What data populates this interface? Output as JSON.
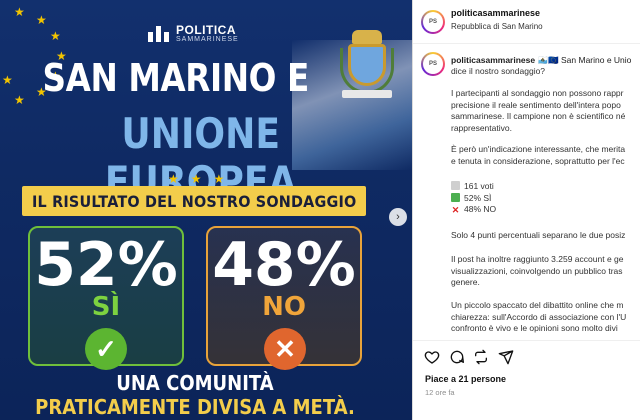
{
  "post_image": {
    "brand_line1": "POLITICA",
    "brand_line2": "SAMMARINESE",
    "title_line1": "SAN MARINO E",
    "title_line2": "UNIONE EUROPEA",
    "banner": "IL RISULTATO DEL NOSTRO SONDAGGIO",
    "yes": {
      "percent": "52%",
      "label": "SÌ",
      "icon": "check-icon",
      "color": "#7dd240"
    },
    "no": {
      "percent": "48%",
      "label": "NO",
      "icon": "x-icon",
      "color": "#f0a53a"
    },
    "footer_line1": "UNA COMUNITÀ",
    "footer_line2": "PRATICAMENTE DIVISA A METÀ."
  },
  "header": {
    "username": "politicasammarinese",
    "location": "Repubblica di San Marino"
  },
  "caption": {
    "username": "politicasammarinese",
    "first_line_rest": " 🇸🇲🇪🇺 San Marino e Unio",
    "first_line_2": "dice il nostro sondaggio?",
    "para1": [
      "I partecipanti al sondaggio non possono rappr",
      "precisione il reale sentimento dell'intera popo",
      "sammarinese. Il campione non è scientifico né",
      "rappresentativo."
    ],
    "para2": [
      "È però un'indicazione interessante, che merita",
      "e tenuta in considerazione, soprattutto per l'ec"
    ],
    "stats": [
      {
        "icon": "chart-icon",
        "text": "161 voti"
      },
      {
        "icon": "check-icon",
        "text": "52% SÌ"
      },
      {
        "icon": "x-icon",
        "text": "48% NO"
      }
    ],
    "para3": [
      "Solo 4 punti percentuali separano le due posiz"
    ],
    "para4": [
      "Il post ha inoltre raggiunto 3.259 account e ge",
      "visualizzazioni, coinvolgendo un pubblico tras",
      "genere."
    ],
    "para5": [
      "Un piccolo spaccato del dibattito online che m",
      "chiarezza: sull'Accordo di associazione con l'U",
      "confronto è vivo e le opinioni sono molto divi"
    ]
  },
  "footer": {
    "likes": "Piace a 21 persone",
    "time": "12 ore fa"
  }
}
